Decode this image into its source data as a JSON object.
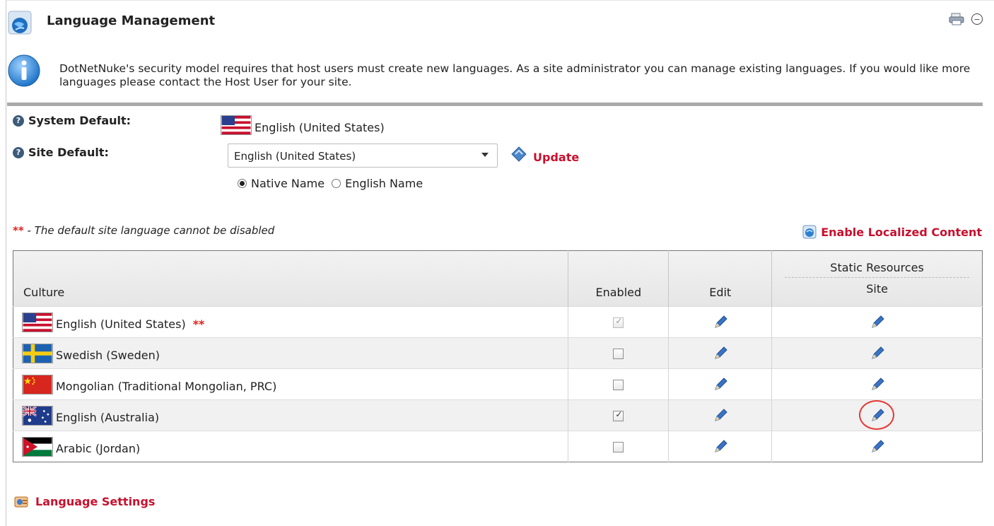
{
  "module": {
    "title": "Language Management",
    "print_icon": "print-icon",
    "minimize_icon": "minimize-icon"
  },
  "info": {
    "text": "DotNetNuke's security model requires that host users must create new languages. As a site administrator you can manage existing languages. If you would like more languages please contact the Host User for your site.",
    "icon": "info-icon"
  },
  "system_default": {
    "label": "System Default:",
    "value": "English (United States)",
    "flag": "us"
  },
  "site_default": {
    "label": "Site Default:",
    "selected": "English (United States)",
    "update_label": "Update",
    "radios": [
      {
        "label": "Native Name",
        "checked": true
      },
      {
        "label": "English Name",
        "checked": false
      }
    ]
  },
  "note": {
    "stars": "**",
    "text": " - The default site language cannot be disabled"
  },
  "enable_localized_content": "Enable Localized Content",
  "grid": {
    "headers": {
      "culture": "Culture",
      "enabled": "Enabled",
      "edit": "Edit",
      "static_resources": "Static Resources",
      "site": "Site"
    },
    "rows": [
      {
        "culture": "English (United States)",
        "flag": "us",
        "default_marker": "**",
        "enabled": true,
        "disabled": true
      },
      {
        "culture": "Swedish (Sweden)",
        "flag": "se",
        "enabled": false
      },
      {
        "culture": "Mongolian (Traditional Mongolian, PRC)",
        "flag": "cn",
        "enabled": false
      },
      {
        "culture": "English (Australia)",
        "flag": "au",
        "enabled": true,
        "highlighted": true
      },
      {
        "culture": "Arabic (Jordan)",
        "flag": "jo",
        "enabled": false
      }
    ]
  },
  "language_settings": "Language Settings",
  "colors": {
    "link_red": "#c8102e",
    "star_red": "#e0201c",
    "divider": "#a9a9a9"
  }
}
